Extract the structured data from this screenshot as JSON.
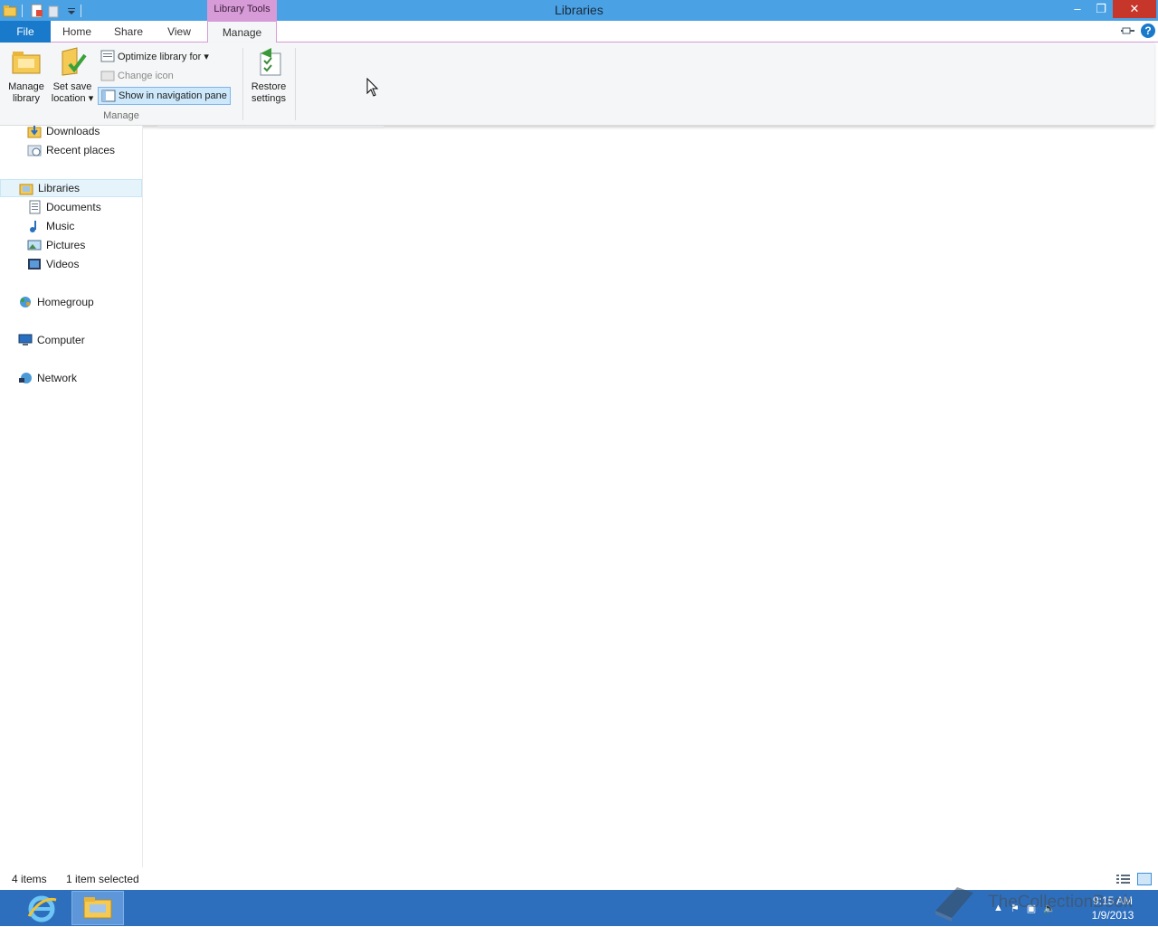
{
  "window": {
    "title": "Libraries",
    "context_tab_group": "Library Tools",
    "controls": {
      "minimize": "–",
      "maximize": "❐",
      "close": "✕"
    }
  },
  "quick_access": {
    "icons": [
      "explorer-icon",
      "properties-icon",
      "new-folder-icon",
      "customize-dropdown-icon"
    ]
  },
  "ribbon_tabs": [
    {
      "label": "File",
      "active": false
    },
    {
      "label": "Home",
      "active": false
    },
    {
      "label": "Share",
      "active": false
    },
    {
      "label": "View",
      "active": false
    },
    {
      "label": "Manage",
      "active": true
    }
  ],
  "ribbon": {
    "manage_library": {
      "line1": "Manage",
      "line2": "library"
    },
    "set_save_location": {
      "line1": "Set save",
      "line2": "location ▾"
    },
    "optimize_library_for": "Optimize library for ▾",
    "change_icon": "Change icon",
    "show_in_navigation_pane": "Show in navigation pane",
    "restore_settings": {
      "line1": "Restore",
      "line2": "settings"
    },
    "group_label": "Manage"
  },
  "nav_pane": {
    "items": [
      {
        "label": "Downloads",
        "icon": "downloads-icon"
      },
      {
        "label": "Recent places",
        "icon": "recent-places-icon"
      },
      {
        "label": "Libraries",
        "icon": "libraries-icon",
        "selected": true
      },
      {
        "label": "Documents",
        "icon": "documents-icon"
      },
      {
        "label": "Music",
        "icon": "music-icon"
      },
      {
        "label": "Pictures",
        "icon": "pictures-icon"
      },
      {
        "label": "Videos",
        "icon": "videos-icon"
      },
      {
        "label": "Homegroup",
        "icon": "homegroup-icon"
      },
      {
        "label": "Computer",
        "icon": "computer-icon"
      },
      {
        "label": "Network",
        "icon": "network-icon"
      }
    ]
  },
  "status_bar": {
    "item_count": "4 items",
    "selection": "1 item selected"
  },
  "taskbar": {
    "pinned": [
      "internet-explorer-icon",
      "file-explorer-icon"
    ],
    "clock_time": "9:15 AM",
    "clock_date": "1/9/2013"
  },
  "watermark": "TheCollectionBook",
  "colors": {
    "titlebar": "#4aa1e4",
    "file_tab": "#1979ca",
    "context_tab": "#d79bd8",
    "taskbar": "#2e6fbd",
    "close_button": "#c7362a"
  }
}
